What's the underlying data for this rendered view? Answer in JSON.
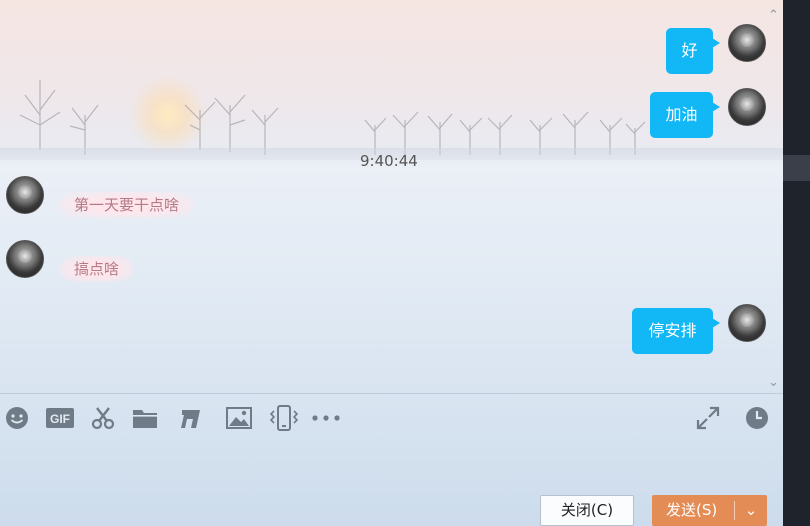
{
  "messages": {
    "outgoing": [
      {
        "text": "好"
      },
      {
        "text": "加油"
      },
      {
        "text": "停安排"
      }
    ],
    "timestamp": "9:40:44",
    "incoming": [
      {
        "text": "第一天要干点啥"
      },
      {
        "text": "搞点啥"
      }
    ]
  },
  "toolbar": {
    "icons": [
      "emoji-icon",
      "gif-icon",
      "scissors-icon",
      "folder-icon",
      "music-icon",
      "image-icon",
      "shake-icon",
      "more-icon",
      "expand-icon",
      "history-clock-icon"
    ],
    "gif_label": "GIF"
  },
  "buttons": {
    "close": "关闭(C)",
    "send": "发送(S)",
    "send_dropdown": "⌄"
  },
  "colors": {
    "outgoing_bubble": "#12b7f5",
    "incoming_text": "#b47a86",
    "send_button": "#e48c55"
  }
}
